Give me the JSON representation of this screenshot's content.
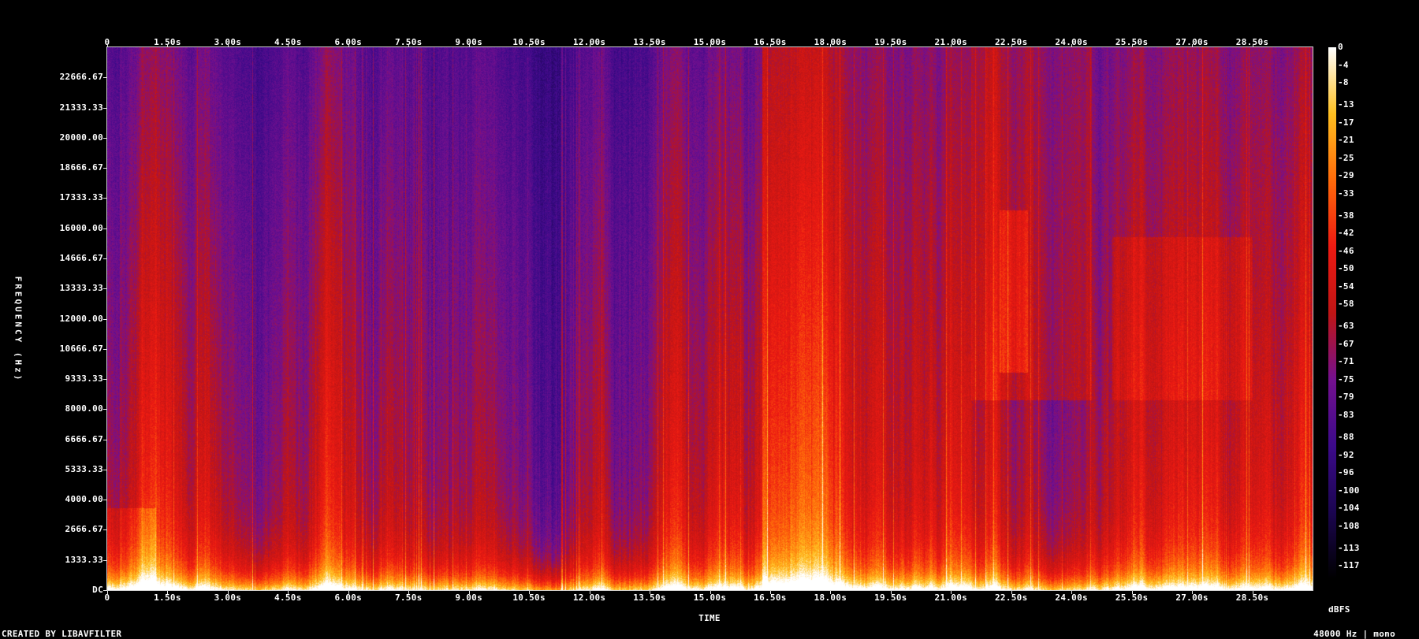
{
  "footer": {
    "credit": "CREATED BY LIBAVFILTER",
    "format": "48000 Hz | mono"
  },
  "chart_data": {
    "type": "heatmap",
    "title": "",
    "xlabel": "TIME",
    "ylabel": "FREQUENCY (Hz)",
    "colorbar_label": "dBFS",
    "x_unit": "s",
    "y_unit": "Hz",
    "xlim": [
      0,
      30
    ],
    "ylim": [
      0,
      24000
    ],
    "x_ticks": [
      "0",
      "1.50s",
      "3.00s",
      "4.50s",
      "6.00s",
      "7.50s",
      "9.00s",
      "10.50s",
      "12.00s",
      "13.50s",
      "15.00s",
      "16.50s",
      "18.00s",
      "19.50s",
      "21.00s",
      "22.50s",
      "24.00s",
      "25.50s",
      "27.00s",
      "28.50s"
    ],
    "y_ticks": [
      "DC",
      "1333.33",
      "2666.67",
      "4000.00",
      "5333.33",
      "6666.67",
      "8000.00",
      "9333.33",
      "10666.67",
      "12000.00",
      "13333.33",
      "14666.67",
      "16000.00",
      "17333.33",
      "18666.67",
      "20000.00",
      "21333.33",
      "22666.67"
    ],
    "colorbar_ticks": [
      "0",
      "-4",
      "-8",
      "-13",
      "-17",
      "-21",
      "-25",
      "-29",
      "-33",
      "-38",
      "-42",
      "-46",
      "-50",
      "-54",
      "-58",
      "-63",
      "-67",
      "-71",
      "-75",
      "-79",
      "-83",
      "-88",
      "-92",
      "-96",
      "-100",
      "-104",
      "-108",
      "-113",
      "-117"
    ],
    "colorbar_range": [
      -120,
      0
    ],
    "colormap": [
      "#000000",
      "#1b0550",
      "#3c0a8a",
      "#74108f",
      "#c01515",
      "#ee1a12",
      "#ff6a0a",
      "#ffc020",
      "#ffffff"
    ],
    "grid": false,
    "sample_rate_hz": 48000,
    "channels": "mono"
  }
}
